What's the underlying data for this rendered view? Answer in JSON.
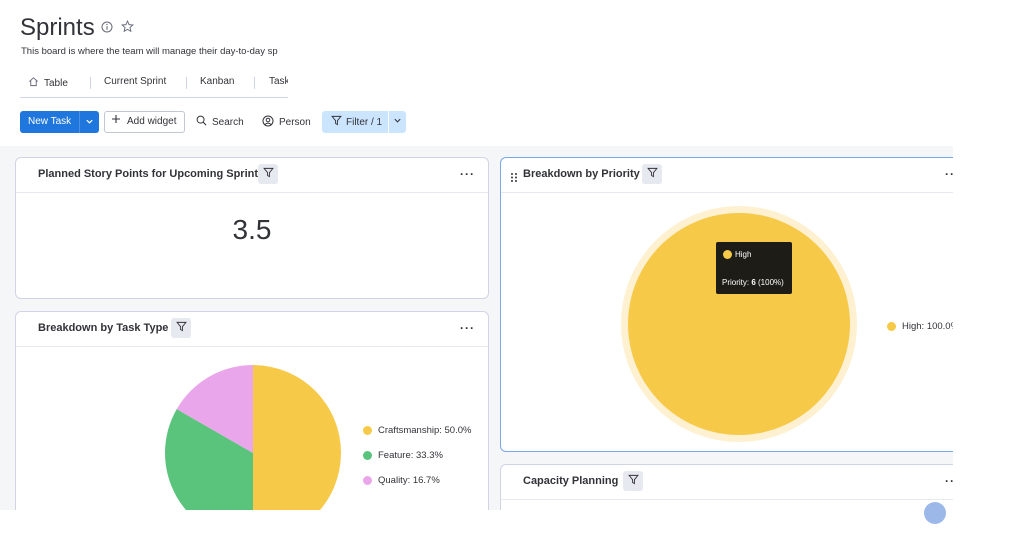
{
  "board": {
    "title": "Sprints",
    "description": "This board is where the team will manage their day-to-day sp"
  },
  "tabs": [
    {
      "label": "Table",
      "icon": "home-icon"
    },
    {
      "label": "Current Sprint"
    },
    {
      "label": "Kanban"
    },
    {
      "label": "Task"
    }
  ],
  "toolbar": {
    "new_task": "New Task",
    "add_widget": "Add widget",
    "search": "Search",
    "person": "Person",
    "filter": "Filter / 1"
  },
  "widgets": {
    "story_points": {
      "title": "Planned Story Points for Upcoming Sprint",
      "value": "3.5"
    },
    "task_type": {
      "title": "Breakdown by Task Type",
      "legend": [
        {
          "label": "Craftsmanship: 50.0%",
          "color": "#f7c948"
        },
        {
          "label": "Feature: 33.3%",
          "color": "#5ac47d"
        },
        {
          "label": "Quality: 16.7%",
          "color": "#e9a6ea"
        }
      ]
    },
    "priority": {
      "title": "Breakdown by Priority",
      "legend": [
        {
          "label": "High: 100.0%",
          "color": "#f7c948"
        }
      ],
      "tooltip": {
        "label": "High",
        "prefix": "Priority: ",
        "count": "6",
        "suffix": " (100%)"
      }
    },
    "capacity": {
      "title": "Capacity Planning"
    }
  },
  "chart_data": [
    {
      "type": "pie",
      "title": "Breakdown by Task Type",
      "categories": [
        "Craftsmanship",
        "Feature",
        "Quality"
      ],
      "values": [
        50.0,
        33.3,
        16.7
      ],
      "colors": [
        "#f7c948",
        "#5ac47d",
        "#e9a6ea"
      ],
      "legend": "right"
    },
    {
      "type": "pie",
      "title": "Breakdown by Priority",
      "categories": [
        "High"
      ],
      "values": [
        100.0
      ],
      "colors": [
        "#f7c948"
      ],
      "legend": "right"
    }
  ]
}
